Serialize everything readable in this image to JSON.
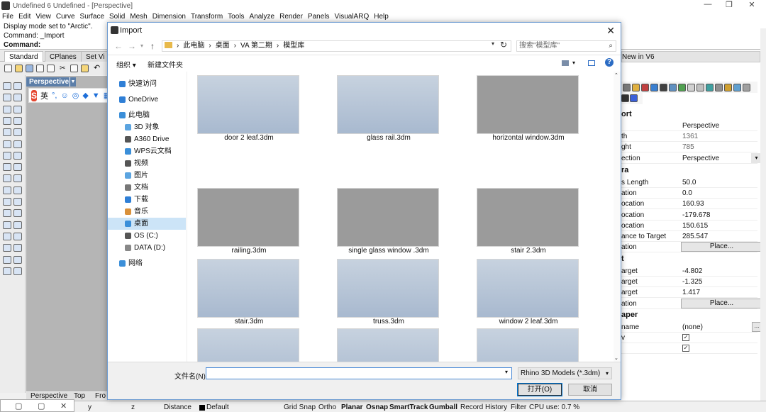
{
  "app": {
    "title": "Undefined 6 Undefined - [Perspective]",
    "menu": [
      "File",
      "Edit",
      "View",
      "Curve",
      "Surface",
      "Solid",
      "Mesh",
      "Dimension",
      "Transform",
      "Tools",
      "Analyze",
      "Render",
      "Panels",
      "VisualARQ",
      "Help"
    ],
    "command_history": [
      "Display mode set to \"Arctic\".",
      "Command: _Import"
    ],
    "command_prompt": "Command:",
    "tabs": [
      "Standard",
      "CPlanes",
      "Set Vi"
    ],
    "viewport_title": "Perspective",
    "viewport_tabs": [
      "Perspective",
      "Top",
      "Fro"
    ],
    "ime": {
      "logo": "S",
      "lang": "英"
    }
  },
  "right_panel": {
    "new_tab": "New in V6",
    "sections": {
      "viewport": "ort",
      "camera": "ra",
      "target": "t",
      "wallpaper": "aper"
    },
    "viewport_rows": [
      {
        "key": "",
        "value": "Perspective",
        "grey": false
      },
      {
        "key": "th",
        "value": "1361",
        "grey": true
      },
      {
        "key": "ght",
        "value": "785",
        "grey": true
      },
      {
        "key": "ection",
        "value": "Perspective",
        "grey": false,
        "dropdown": true
      }
    ],
    "camera_rows": [
      {
        "key": "s Length",
        "value": "50.0"
      },
      {
        "key": "ation",
        "value": "0.0"
      },
      {
        "key": "ocation",
        "value": "160.93"
      },
      {
        "key": "ocation",
        "value": "-179.678"
      },
      {
        "key": "ocation",
        "value": "150.615"
      },
      {
        "key": "ance to Target",
        "value": "285.547"
      },
      {
        "key": "ation",
        "value": "Place...",
        "button": true
      }
    ],
    "target_rows": [
      {
        "key": "arget",
        "value": "-4.802"
      },
      {
        "key": "arget",
        "value": "-1.325"
      },
      {
        "key": "arget",
        "value": "1.417"
      },
      {
        "key": "ation",
        "value": "Place...",
        "button": true
      }
    ],
    "wallpaper_rows": [
      {
        "key": "name",
        "value": "(none)"
      },
      {
        "key": "v",
        "value": "✓",
        "check": true
      },
      {
        "key": "",
        "value": "✓",
        "check": true
      }
    ]
  },
  "dialog": {
    "title": "Import",
    "close": "✕",
    "path": [
      "此电脑",
      "桌面",
      "VA 第二期",
      "模型库"
    ],
    "search_placeholder": "搜索\"模型库\"",
    "organize": "组织 ▾",
    "new_folder": "新建文件夹",
    "nav": [
      {
        "label": "快速访问",
        "color": "#2f7fd6"
      },
      {
        "label": "OneDrive",
        "color": "#2f7fd6"
      },
      {
        "label": "此电脑",
        "color": "#3b8fd9"
      },
      {
        "label": "3D 对象",
        "color": "#5ba4e0"
      },
      {
        "label": "A360 Drive",
        "color": "#555"
      },
      {
        "label": "WPS云文档",
        "color": "#3b8fd9"
      },
      {
        "label": "视频",
        "color": "#555"
      },
      {
        "label": "图片",
        "color": "#5ba4e0"
      },
      {
        "label": "文档",
        "color": "#777"
      },
      {
        "label": "下载",
        "color": "#2f7fd6"
      },
      {
        "label": "音乐",
        "color": "#d9913b"
      },
      {
        "label": "桌面",
        "color": "#3b8fd9",
        "selected": true
      },
      {
        "label": "OS (C:)",
        "color": "#555"
      },
      {
        "label": "DATA (D:)",
        "color": "#888"
      },
      {
        "label": "网络",
        "color": "#3b8fd9"
      }
    ],
    "files": [
      {
        "name": "door 2 leaf.3dm",
        "bg": "sky"
      },
      {
        "name": "glass rail.3dm",
        "bg": "sky"
      },
      {
        "name": "horizontal window.3dm",
        "bg": "gry"
      },
      {
        "name": "railing.3dm",
        "bg": "gry"
      },
      {
        "name": "single glass window .3dm",
        "bg": "gry"
      },
      {
        "name": "stair 2.3dm",
        "bg": "gry"
      },
      {
        "name": "stair.3dm",
        "bg": "sky"
      },
      {
        "name": "truss.3dm",
        "bg": "sky"
      },
      {
        "name": "window 2 leaf.3dm",
        "bg": "sky"
      },
      {
        "name": "",
        "bg": "sky"
      },
      {
        "name": "",
        "bg": "sky"
      },
      {
        "name": "",
        "bg": "sky"
      }
    ],
    "filename_label": "文件名(N):",
    "filename_value": "",
    "filetype": "Rhino 3D Models (*.3dm)",
    "open_button": "打开(O)",
    "cancel_button": "取消"
  },
  "status": {
    "y": "y",
    "z": "z",
    "distance": "Distance",
    "layer": "Default",
    "grid_snap": "Grid Snap",
    "ortho": "Ortho",
    "planar": "Planar",
    "osnap": "Osnap",
    "smarttrack": "SmartTrack",
    "gumball": "Gumball",
    "record_history": "Record History",
    "filter": "Filter",
    "cpu": "CPU use: 0.7 %"
  }
}
